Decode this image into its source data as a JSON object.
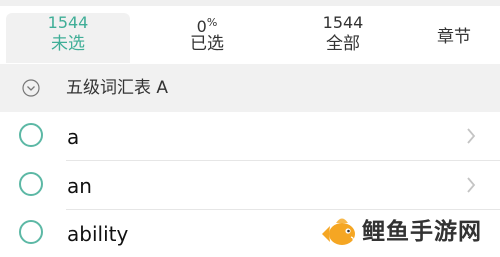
{
  "tabs": [
    {
      "count": "1544",
      "label": "未选",
      "active": true
    },
    {
      "count": "0",
      "count_suffix": "%",
      "label": "已选",
      "active": false
    },
    {
      "count": "1544",
      "label": "全部",
      "active": false
    },
    {
      "count": "",
      "label": "章节",
      "active": false
    }
  ],
  "section": {
    "title": "五级词汇表 A",
    "icon": "chevron-down-circle-icon"
  },
  "words": [
    {
      "text": "a",
      "has_chevron": true
    },
    {
      "text": "an",
      "has_chevron": true
    },
    {
      "text": "ability",
      "has_chevron": false
    }
  ],
  "watermark": {
    "text": "鲤鱼手游网",
    "icon": "carp-fish-logo"
  },
  "colors": {
    "accent": "#3fae97",
    "circle": "#5cb8a5",
    "header_bg": "#f1f1f1",
    "logo_orange": "#f5a623"
  }
}
